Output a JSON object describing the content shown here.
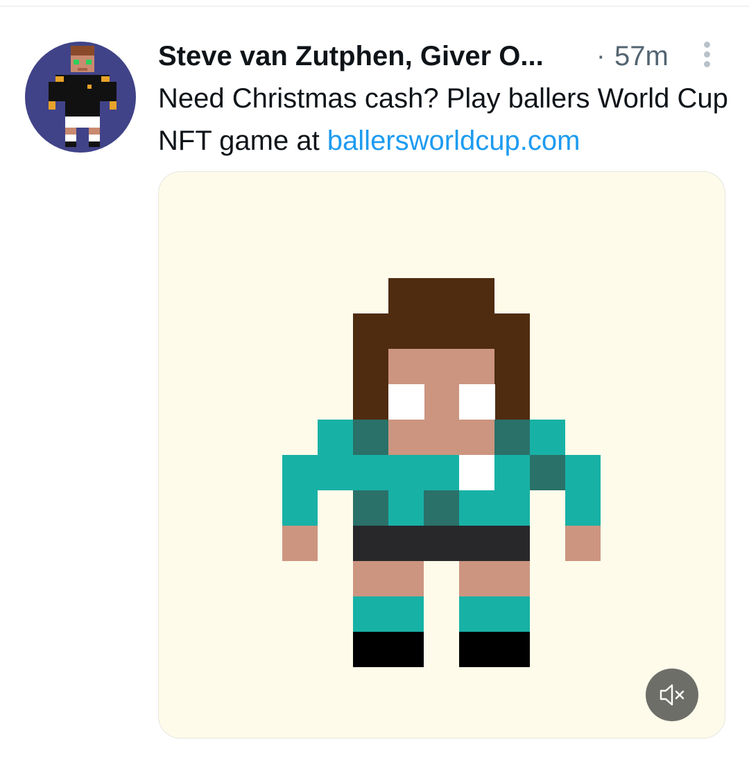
{
  "tweet": {
    "author_name": "Steve van Zutphen, Giver O...",
    "separator": "·",
    "timestamp": "57m",
    "text": "Need Christmas cash? Play ballers World Cup NFT game at ",
    "link_text": "ballersworldcup.com"
  },
  "icons": {
    "more": "more-vertical-icon",
    "mute": "speaker-muted-icon"
  },
  "colors": {
    "link": "#1d9bf0",
    "name": "#0f1419",
    "secondary": "#536471",
    "media_background": "#fefbea",
    "avatar_background": "#414388"
  }
}
